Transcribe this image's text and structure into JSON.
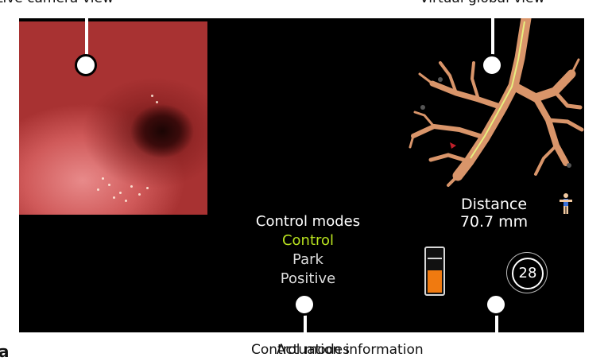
{
  "captions": {
    "live_camera": "Live camera view",
    "virtual_global": "Virtual global view",
    "panel_letter": "a",
    "control_modes": "Control modes",
    "actuation": "Actuation information"
  },
  "navigation": {
    "distance_label": "Distance",
    "distance_value": "70.7 mm"
  },
  "control_modes": {
    "title": "Control modes",
    "active": "Control",
    "options": [
      "Park",
      "Positive"
    ]
  },
  "actuation": {
    "battery_level": 0.7,
    "counter": "28"
  },
  "colors": {
    "active_mode": "#b9e31f",
    "battery_fill": "#f07a10",
    "lung_tree": "#d9956a",
    "path_highlight": "#e8f080"
  }
}
